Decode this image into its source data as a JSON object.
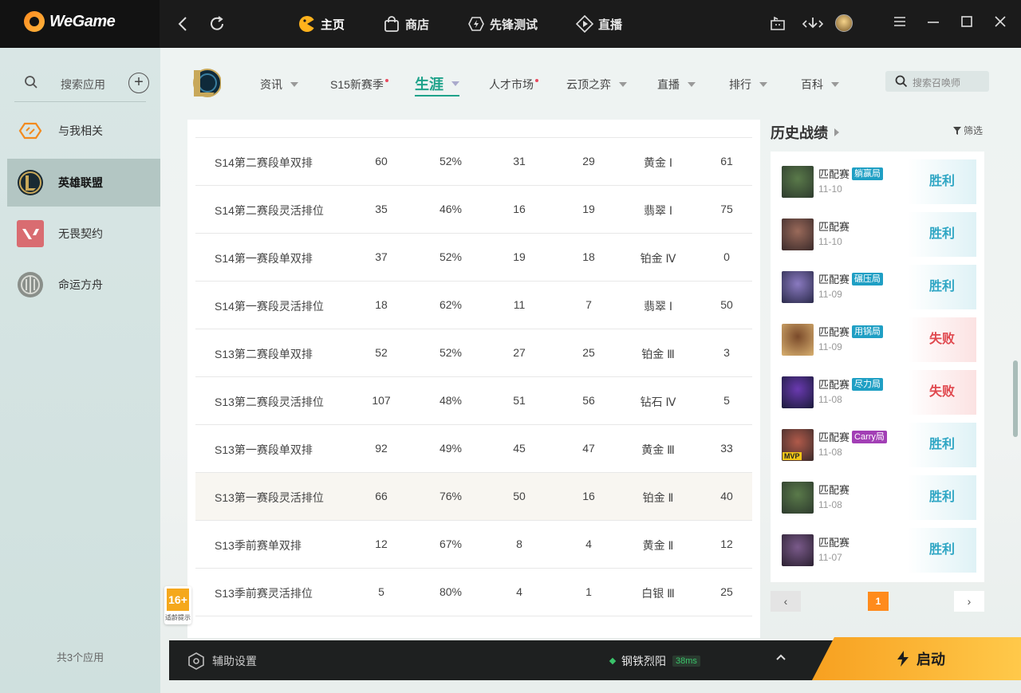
{
  "app": {
    "logo_text": "WeGame",
    "top_nav": [
      {
        "label": "主页",
        "icon": "home-icon"
      },
      {
        "label": "商店",
        "icon": "shop-bag-icon"
      },
      {
        "label": "先锋测试",
        "icon": "lightning-test-icon"
      },
      {
        "label": "直播",
        "icon": "live-play-icon"
      }
    ]
  },
  "sidebar": {
    "search_label": "搜索应用",
    "items": [
      {
        "label": "与我相关",
        "active": false
      },
      {
        "label": "英雄联盟",
        "active": true
      },
      {
        "label": "无畏契约",
        "active": false
      },
      {
        "label": "命运方舟",
        "active": false
      }
    ],
    "count_text": "共3个应用"
  },
  "subnav": {
    "tabs": [
      {
        "label": "资讯"
      },
      {
        "label": "S15新赛季"
      },
      {
        "label": "生涯"
      },
      {
        "label": "人才市场"
      },
      {
        "label": "云顶之弈"
      },
      {
        "label": "直播"
      },
      {
        "label": "排行"
      },
      {
        "label": "百科"
      }
    ],
    "search_placeholder": "搜索召唤师"
  },
  "stats_table": {
    "rows": [
      [
        "S14第二赛段单双排",
        "60",
        "52%",
        "31",
        "29",
        "黄金 Ⅰ",
        "61"
      ],
      [
        "S14第二赛段灵活排位",
        "35",
        "46%",
        "16",
        "19",
        "翡翠 Ⅰ",
        "75"
      ],
      [
        "S14第一赛段单双排",
        "37",
        "52%",
        "19",
        "18",
        "铂金 Ⅳ",
        "0"
      ],
      [
        "S14第一赛段灵活排位",
        "18",
        "62%",
        "11",
        "7",
        "翡翠 Ⅰ",
        "50"
      ],
      [
        "S13第二赛段单双排",
        "52",
        "52%",
        "27",
        "25",
        "铂金 Ⅲ",
        "3"
      ],
      [
        "S13第二赛段灵活排位",
        "107",
        "48%",
        "51",
        "56",
        "钻石 Ⅳ",
        "5"
      ],
      [
        "S13第一赛段单双排",
        "92",
        "49%",
        "45",
        "47",
        "黄金 Ⅲ",
        "33"
      ],
      [
        "S13第一赛段灵活排位",
        "66",
        "76%",
        "50",
        "16",
        "铂金 Ⅱ",
        "40"
      ],
      [
        "S13季前赛单双排",
        "12",
        "67%",
        "8",
        "4",
        "黄金 Ⅱ",
        "12"
      ],
      [
        "S13季前赛灵活排位",
        "5",
        "80%",
        "4",
        "1",
        "白银 Ⅲ",
        "25"
      ]
    ]
  },
  "history": {
    "title": "历史战绩",
    "filter_label": "筛选",
    "matches": [
      {
        "mode": "匹配赛",
        "tag": "躺赢局",
        "tag_color": "#1f9fc4",
        "date": "11-10",
        "result": "胜利",
        "win": true,
        "mvp": false
      },
      {
        "mode": "匹配赛",
        "tag": "",
        "tag_color": "",
        "date": "11-10",
        "result": "胜利",
        "win": true,
        "mvp": false
      },
      {
        "mode": "匹配赛",
        "tag": "碾压局",
        "tag_color": "#1f9fc4",
        "date": "11-09",
        "result": "胜利",
        "win": true,
        "mvp": false
      },
      {
        "mode": "匹配赛",
        "tag": "用锅局",
        "tag_color": "#1f9fc4",
        "date": "11-09",
        "result": "失败",
        "win": false,
        "mvp": false
      },
      {
        "mode": "匹配赛",
        "tag": "尽力局",
        "tag_color": "#1f9fc4",
        "date": "11-08",
        "result": "失败",
        "win": false,
        "mvp": false
      },
      {
        "mode": "匹配赛",
        "tag": "Carry局",
        "tag_color": "#a23fb5",
        "date": "11-08",
        "result": "胜利",
        "win": true,
        "mvp": true
      },
      {
        "mode": "匹配赛",
        "tag": "",
        "tag_color": "",
        "date": "11-08",
        "result": "胜利",
        "win": true,
        "mvp": false
      },
      {
        "mode": "匹配赛",
        "tag": "",
        "tag_color": "",
        "date": "11-07",
        "result": "胜利",
        "win": true,
        "mvp": false
      }
    ],
    "mvp_label": "MVP",
    "page": "1",
    "prev": "‹",
    "next": "›"
  },
  "age_badge": {
    "number": "16+",
    "caption": "适龄提示"
  },
  "bottom": {
    "assist_label": "辅助设置",
    "server_name": "钢铁烈阳",
    "ping": "38ms",
    "launch_label": "启动"
  },
  "colors": {
    "accent": "#1ea28a",
    "launch": "#f7a020",
    "win": "#2fa6c4",
    "lose": "#e0484e"
  }
}
